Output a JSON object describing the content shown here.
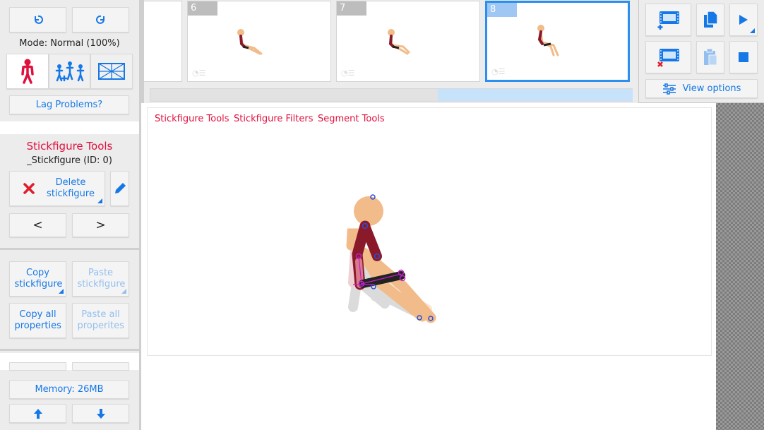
{
  "left_panel": {
    "undo_icon": "undo-icon",
    "redo_icon": "redo-icon",
    "mode_label": "Mode: Normal (100%)",
    "tool_tabs": [
      "single-stickfigure-icon",
      "group-stickfigures-icon",
      "scene-icon"
    ],
    "lag_button": "Lag Problems?",
    "section_title": "Stickfigure Tools",
    "selected_figure": "_Stickfigure (ID: 0)",
    "delete_button": "Delete stickfigure",
    "edit_icon": "pencil-icon",
    "prev_button": "<",
    "next_button": ">",
    "copy_stickfigure": "Copy stickfigure",
    "paste_stickfigure": "Paste stickfigure",
    "copy_all": "Copy all properties",
    "paste_all": "Paste all properites",
    "memory": "Memory: 26MB"
  },
  "timeline": {
    "frames": [
      {
        "number": "6",
        "active": false
      },
      {
        "number": "7",
        "active": false
      },
      {
        "number": "8",
        "active": true
      }
    ]
  },
  "right_panel": {
    "add_frame_icon": "add-frame-icon",
    "copy_frame_icon": "copy-frame-icon",
    "play_icon": "play-icon",
    "delete_frame_icon": "delete-frame-icon",
    "paste_frame_icon": "paste-frame-icon",
    "stop_icon": "stop-icon",
    "view_options": "View options"
  },
  "canvas_menu": {
    "stickfigure_tools": "Stickfigure Tools",
    "stickfigure_filters": "Stickfigure Filters",
    "segment_tools": "Segment Tools"
  },
  "colors": {
    "accent_blue": "#1578e6",
    "accent_red": "#e0103c",
    "figure_skin": "#f2bb8a",
    "figure_maroon": "#8a1a2a",
    "selection_blue": "#2a8ff0"
  }
}
